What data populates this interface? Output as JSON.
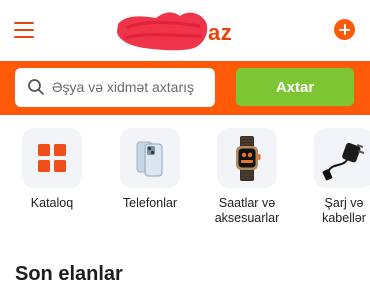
{
  "header": {
    "menu_icon": "hamburger-menu-icon",
    "logo_suffix": "az",
    "add_icon": "plus-circle-icon",
    "accent_color": "#e8430d"
  },
  "search": {
    "placeholder": "Əşya və xidmət axtarış",
    "icon": "search-icon",
    "submit_label": "Axtar",
    "band_color": "#ff5a0a",
    "button_color": "#7ec534"
  },
  "categories": [
    {
      "label_lines": [
        "Kataloq"
      ],
      "icon": "grid-icon"
    },
    {
      "label_lines": [
        "Telefonlar"
      ],
      "icon": "phone-icon"
    },
    {
      "label_lines": [
        "Saatlar və",
        "aksesuarlar"
      ],
      "icon": "watch-icon"
    },
    {
      "label_lines": [
        "Şarj və",
        "kabellər"
      ],
      "icon": "charger-cable-icon"
    }
  ],
  "sections": {
    "recent_title": "Son elanlar"
  }
}
